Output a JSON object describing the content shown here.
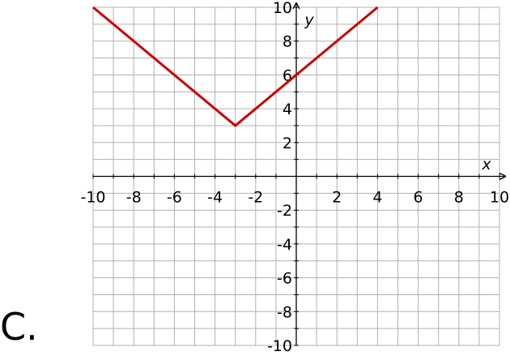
{
  "choice_label": "C.",
  "colors": {
    "grid": "#b0b0b0",
    "axis": "#000000",
    "curve": "#cc0000",
    "background": "#ffffff"
  },
  "chart_data": {
    "type": "line",
    "title": "",
    "xlabel": "x",
    "ylabel": "y",
    "xlim": [
      -10,
      10
    ],
    "ylim": [
      -10,
      10
    ],
    "grid": true,
    "grid_step": 1,
    "x_ticks": [
      -10,
      -8,
      -6,
      -4,
      -2,
      2,
      4,
      6,
      8,
      10
    ],
    "y_ticks": [
      -10,
      -8,
      -6,
      -4,
      -2,
      2,
      4,
      6,
      8,
      10
    ],
    "x_tick_labels": [
      "-10",
      "-8",
      "-6",
      "-4",
      "-2",
      "2",
      "4",
      "6",
      "8",
      "10"
    ],
    "y_tick_labels": [
      "-10",
      "-8",
      "-6",
      "-4",
      "-2",
      "2",
      "4",
      "6",
      "8",
      "10"
    ],
    "series": [
      {
        "x": [
          -10,
          -3,
          4
        ],
        "y": [
          10,
          3,
          10
        ]
      }
    ]
  }
}
